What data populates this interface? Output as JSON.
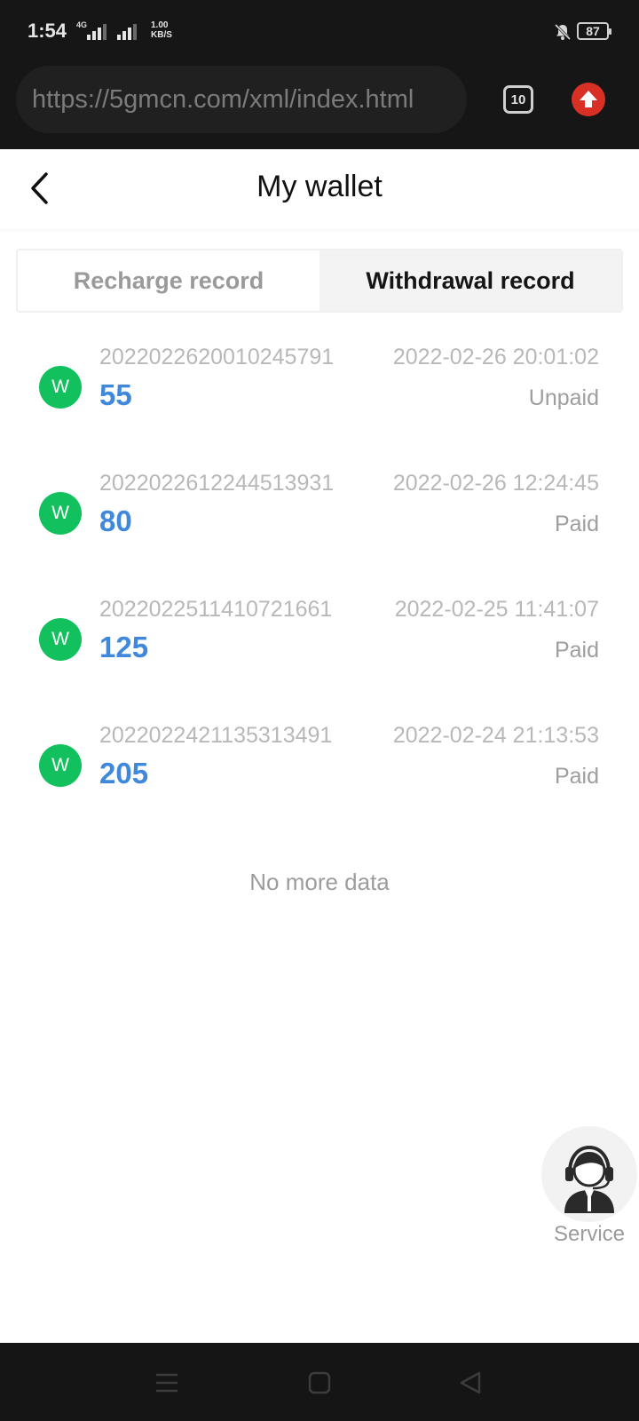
{
  "status_bar": {
    "time": "1:54",
    "network": "4G",
    "speed_value": "1.00",
    "speed_unit": "KB/S",
    "battery": "87"
  },
  "browser": {
    "url": "https://5gmcn.com/xml/index.html",
    "tab_count": "10"
  },
  "header": {
    "title": "My wallet"
  },
  "tabs": [
    {
      "label": "Recharge record",
      "active": false
    },
    {
      "label": "Withdrawal record",
      "active": true
    }
  ],
  "records": [
    {
      "avatar": "W",
      "order": "2022022620010245791",
      "time": "2022-02-26 20:01:02",
      "amount": "55",
      "status": "Unpaid"
    },
    {
      "avatar": "W",
      "order": "2022022612244513931",
      "time": "2022-02-26 12:24:45",
      "amount": "80",
      "status": "Paid"
    },
    {
      "avatar": "W",
      "order": "2022022511410721661",
      "time": "2022-02-25 11:41:07",
      "amount": "125",
      "status": "Paid"
    },
    {
      "avatar": "W",
      "order": "2022022421135313491",
      "time": "2022-02-24 21:13:53",
      "amount": "205",
      "status": "Paid"
    }
  ],
  "footer": {
    "no_more": "No more data"
  },
  "service": {
    "label": "Service"
  },
  "colors": {
    "amount": "#3f88dc",
    "avatar": "#12c15e",
    "update_badge": "#d93025"
  }
}
